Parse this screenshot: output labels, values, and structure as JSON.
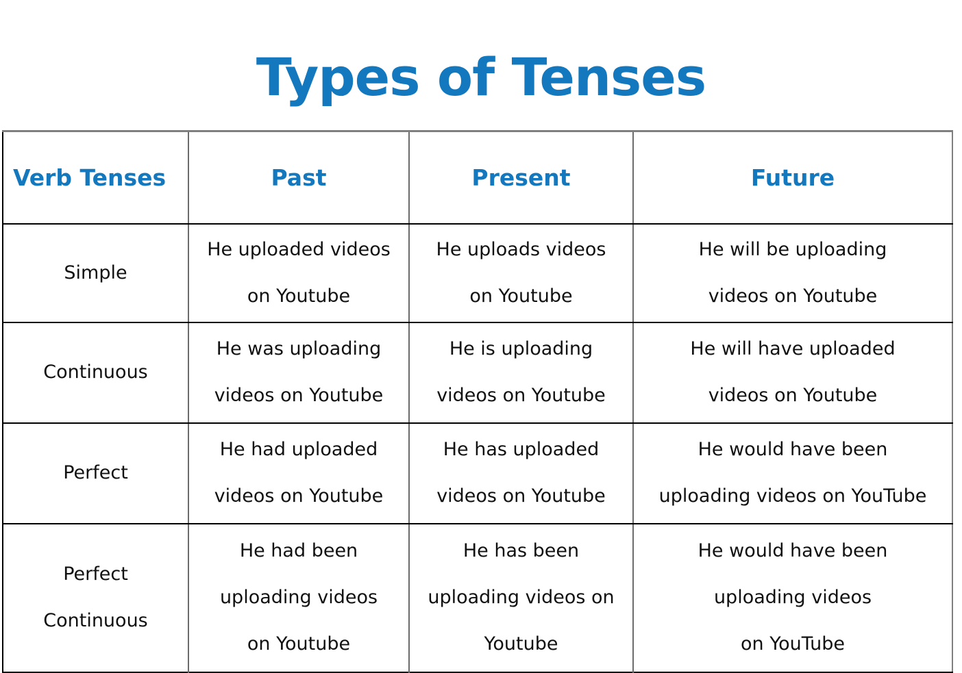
{
  "title": "Types of Tenses",
  "accent_color": "#1478BE",
  "text_color": "#000000",
  "border_color": "#000000",
  "table": {
    "columns": [
      "Verb Tenses",
      "Past",
      "Present",
      "Future"
    ],
    "headers": {
      "label": "Verb Tenses",
      "past": "Past",
      "present": "Present",
      "future": "Future"
    },
    "rows": [
      {
        "label": "Simple",
        "label_lines": [
          "Simple"
        ],
        "past": "He uploaded videos on Youtube",
        "past_lines": [
          "He uploaded videos",
          "on Youtube"
        ],
        "present": "He uploads videos on Youtube",
        "present_lines": [
          "He uploads videos",
          "on Youtube"
        ],
        "future": "He will be uploading videos on Youtube",
        "future_lines": [
          "He will be uploading",
          "videos on Youtube"
        ]
      },
      {
        "label": "Continuous",
        "label_lines": [
          "Continuous"
        ],
        "past": "He was uploading videos on Youtube",
        "past_lines": [
          "He was uploading",
          "videos on Youtube"
        ],
        "present": "He is uploading videos on Youtube",
        "present_lines": [
          "He is uploading",
          "videos on Youtube"
        ],
        "future": "He will have uploaded videos on Youtube",
        "future_lines": [
          "He will have uploaded",
          "videos on Youtube"
        ]
      },
      {
        "label": "Perfect",
        "label_lines": [
          "Perfect"
        ],
        "past": "He had uploaded videos on Youtube",
        "past_lines": [
          "He had uploaded",
          "videos on Youtube"
        ],
        "present": "He has uploaded videos on Youtube",
        "present_lines": [
          "He has uploaded",
          "videos on Youtube"
        ],
        "future": "He would have been uploading videos on YouTube",
        "future_lines": [
          "He would have been",
          "uploading videos on YouTube"
        ]
      },
      {
        "label": "Perfect Continuous",
        "label_lines": [
          "Perfect",
          "Continuous"
        ],
        "past": "He had been uploading videos on Youtube",
        "past_lines": [
          "He had been",
          "uploading videos",
          "on Youtube"
        ],
        "present": "He has been uploading videos on Youtube",
        "present_lines": [
          "He has been",
          "uploading videos on",
          "Youtube"
        ],
        "future": "He would have been uploading videos on YouTube",
        "future_lines": [
          "He would have been",
          "uploading videos",
          "on YouTube"
        ]
      }
    ]
  }
}
